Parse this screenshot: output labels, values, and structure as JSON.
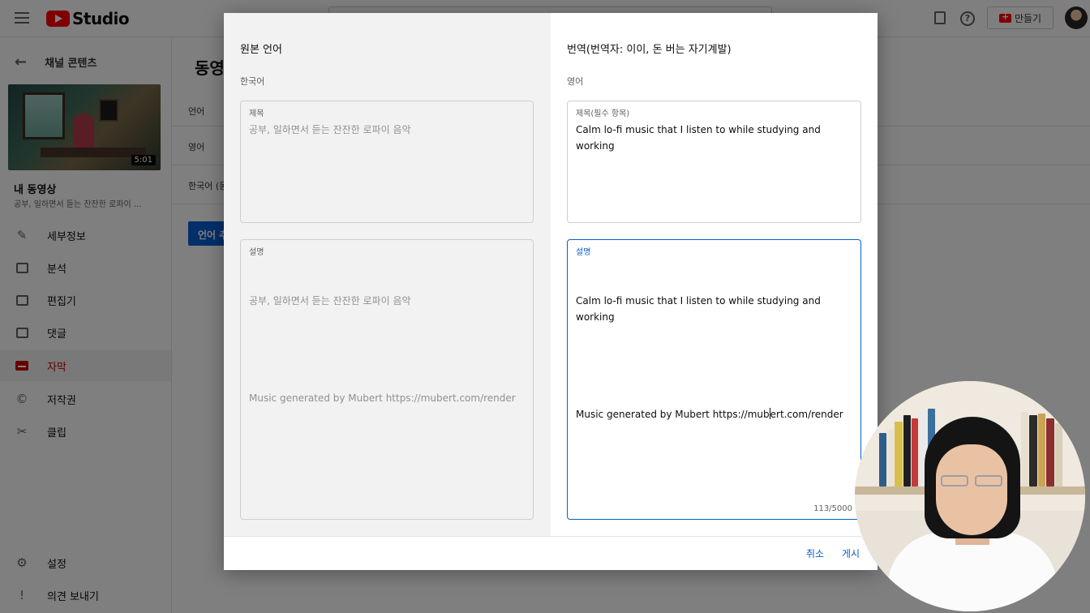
{
  "app": {
    "brand": "Studio",
    "create_label": "만들기"
  },
  "sidebar": {
    "back_label": "채널 콘텐츠",
    "video_duration": "5:01",
    "my_video_label": "내 동영상",
    "video_title": "공부, 일하면서 듣는 잔잔한 로파이 ...",
    "items": [
      {
        "label": "세부정보",
        "icon": "pencil-icon"
      },
      {
        "label": "분석",
        "icon": "analytics-icon"
      },
      {
        "label": "편집기",
        "icon": "editor-icon"
      },
      {
        "label": "댓글",
        "icon": "comments-icon"
      },
      {
        "label": "자막",
        "icon": "subtitles-icon",
        "active": true
      },
      {
        "label": "저작권",
        "icon": "copyright-icon"
      },
      {
        "label": "클립",
        "icon": "scissors-icon"
      }
    ],
    "settings_label": "설정",
    "feedback_label": "의견 보내기"
  },
  "main": {
    "title": "동영",
    "rows": [
      "언어",
      "영어",
      "한국어 (동"
    ],
    "language_button": "언어 추"
  },
  "dialog": {
    "left": {
      "heading": "원본 언어",
      "language": "한국어",
      "title_label": "제목",
      "title_value": "공부, 일하면서 듣는 잔잔한 로파이 음악",
      "description_label": "설명",
      "description_line1": "공부, 일하면서 듣는 잔잔한 로파이 음악",
      "description_line2": "Music generated by Mubert https://mubert.com/render"
    },
    "right": {
      "heading": "번역(번역자: 이이, 돈 버는 자기계발)",
      "language": "영어",
      "title_label": "제목(필수 항목)",
      "title_value": "Calm lo-fi music that I listen to while studying and working",
      "description_label": "설명",
      "description_line1": "Calm lo-fi music that I listen to while studying and working",
      "description_line2_before_caret": "Music generated by Mubert https://mub",
      "description_line2_after_caret": "ert.com/render",
      "char_count": "113/5000"
    },
    "footer": {
      "cancel_label": "취소",
      "publish_label": "게시"
    }
  },
  "colors": {
    "accent": "#065fd4",
    "brand_red": "#ff0000",
    "active_nav": "#cc0000"
  }
}
